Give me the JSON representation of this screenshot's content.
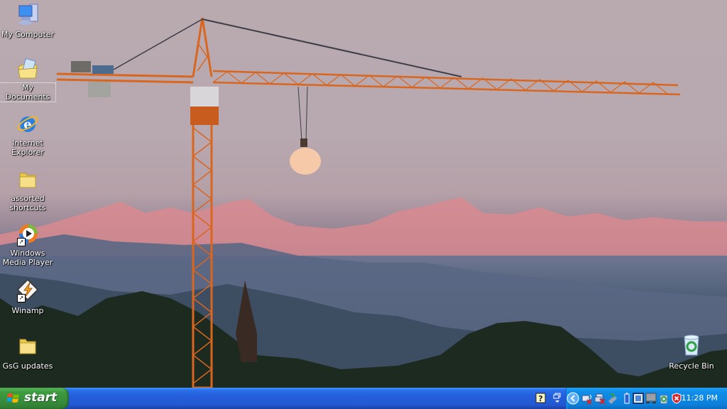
{
  "desktop": {
    "icons": [
      {
        "label": "My Computer",
        "icon": "my-computer-icon",
        "selected": false
      },
      {
        "label": "My Documents",
        "icon": "my-documents-icon",
        "selected": true
      },
      {
        "label": "Internet Explorer",
        "icon": "internet-explorer-icon",
        "selected": false
      },
      {
        "label": "assorted shortcuts",
        "icon": "folder-icon",
        "selected": false
      },
      {
        "label": "Windows Media Player",
        "icon": "windows-media-player-icon",
        "shortcut": true
      },
      {
        "label": "Winamp",
        "icon": "winamp-icon",
        "shortcut": true
      },
      {
        "label": "GsG updates",
        "icon": "folder-icon",
        "selected": false
      },
      {
        "label": "Recycle Bin",
        "icon": "recycle-bin-icon",
        "selected": false
      }
    ],
    "wallpaper": "crane-moon-mountains"
  },
  "taskbar": {
    "start_label": "start",
    "tray": {
      "clock": "11:28 PM",
      "icons": [
        "help-icon",
        "language-bar-icon",
        "show-hidden-icons-chevron",
        "wireless-network-disconnected-icon",
        "network-disconnected-icon",
        "safely-remove-hardware-icon",
        "battery-icon",
        "display-settings-icon",
        "network-monitor-icon",
        "recycle-tray-icon",
        "security-alert-icon"
      ]
    }
  },
  "colors": {
    "taskbar_blue": "#245edb",
    "start_green": "#388e3c",
    "tray_blue": "#0f8ee9",
    "crane_orange": "#d9661f"
  }
}
